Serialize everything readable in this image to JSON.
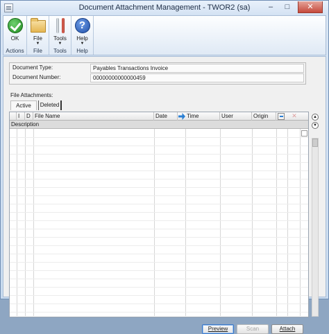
{
  "window": {
    "title": "Document Attachment Management - TWOR2 (sa)",
    "minimize": "–",
    "maximize": "□",
    "close": "✕"
  },
  "ribbon": {
    "groups": [
      {
        "label": "Actions",
        "button": "OK",
        "icon": "ok-check-icon"
      },
      {
        "label": "File",
        "button": "File",
        "icon": "folder-icon"
      },
      {
        "label": "Tools",
        "button": "Tools",
        "icon": "tools-icon"
      },
      {
        "label": "Help",
        "button": "Help",
        "icon": "help-icon"
      }
    ],
    "dropdown_arrow": "▼"
  },
  "document": {
    "type_label": "Document Type:",
    "type_value": "Payables Transactions Invoice",
    "number_label": "Document Number:",
    "number_value": "00000000000000459"
  },
  "attachments": {
    "label": "File Attachments:",
    "tabs": [
      "Active",
      "Deleted"
    ],
    "columns": {
      "i": "I",
      "d": "D",
      "file_name": "File Name",
      "date": "Date",
      "time": "Time",
      "user": "User",
      "origin": "Origin"
    },
    "description_label": "Description"
  },
  "buttons": {
    "preview": "Preview",
    "scan": "Scan",
    "attach": "Attach"
  }
}
